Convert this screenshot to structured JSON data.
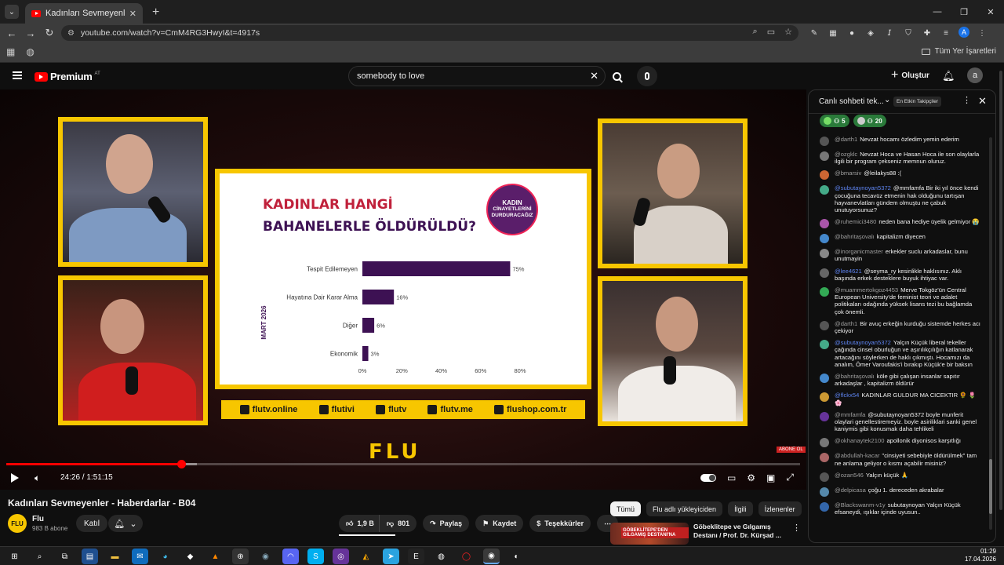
{
  "browser": {
    "tab_title": "Kadınları Sevmeyenler - Haberdarlar",
    "url": "youtube.com/watch?v=CmM4RG3HwyI&t=4917s",
    "profile_initial": "A",
    "bookmarks_label": "Tüm Yer İşaretleri"
  },
  "yt": {
    "logo": "Premium",
    "logo_sup": "AT",
    "search_value": "somebody to love",
    "create_label": "Oluştur",
    "account_initial": "a"
  },
  "video": {
    "slide_title_1": "KADINLAR HANGİ",
    "slide_title_2": "BAHANELERLE ÖLDÜRÜLDÜ?",
    "badge_line1": "KADIN",
    "badge_line2": "CİNAYETLERİNİ",
    "badge_line3": "DURDURACAĞIZ",
    "social": [
      {
        "label": "flutv.online"
      },
      {
        "label": "flutivi"
      },
      {
        "label": "flutv"
      },
      {
        "label": "flutv.me"
      },
      {
        "label": "flushop.com.tr"
      }
    ],
    "brand": "FLU",
    "abone": "ABONE OL",
    "time": "24:26 / 1:51:15",
    "progress_played": 0.22,
    "progress_buffered": 0.24
  },
  "chart_data": {
    "type": "bar",
    "orientation": "horizontal",
    "title": "KADINLAR HANGİ BAHANELERLE ÖLDÜRÜLDÜ?",
    "ylabel": "MART 2026",
    "categories": [
      "Tespit Edilemeyen",
      "Hayatına Dair Karar Alma",
      "Diğer",
      "Ekonomik"
    ],
    "values": [
      75,
      16,
      6,
      3
    ],
    "value_labels": [
      "75%",
      "16%",
      "6%",
      "3%"
    ],
    "xticks": [
      "0%",
      "20%",
      "40%",
      "60%",
      "80%"
    ],
    "xlim": [
      0,
      80
    ],
    "bar_color": "#3d1153"
  },
  "below": {
    "title": "Kadınları Sevmeyenler - Haberdarlar - B04",
    "channel": "Flu",
    "channel_avatar": "FLU",
    "subs": "983 B abone",
    "joined": "Katıl",
    "likes": "1,9 B",
    "dislikes": "801",
    "share": "Paylaş",
    "save": "Kaydet",
    "thanks": "Teşekkürler",
    "chips": [
      "Tümü",
      "Flu adlı yükleyiciden",
      "İlgili",
      "İzlenenler"
    ],
    "reco_title": "Göbeklitepe ve Gılgamış Destanı / Prof. Dr. Kürşad ...",
    "reco_thumb_text": "GÖBEKLİTEPE'DEN GILGAMIŞ DESTANI'NA"
  },
  "chat": {
    "title": "Canlı sohbeti tek...",
    "top_fans": "En Etkin Takipçiler",
    "gift1": "5",
    "gift2": "20",
    "messages": [
      {
        "author": "@darth1",
        "text": "Nevzat hocamı özledim yemin ederim",
        "color": "#555"
      },
      {
        "author": "@ozgklc",
        "text": "Nevzat Hoca ve Hasan Hoca ile son olaylarla ilgili bir program çekseniz memnun oluruz.",
        "color": "#777"
      },
      {
        "author": "@bmarsiv",
        "text": "@leilakys88 :(",
        "color": "#c63"
      },
      {
        "author": "@subutaynoyan5372",
        "text": "@mmfamfa Bir iki yıl önce kendi çocuğuna tecavüz etmenin hak olduğunu tartışan hayvanevlatları gündem olmuştu ne çabuk unutuyorsunuz?",
        "color": "#4a8",
        "mod": true
      },
      {
        "author": "@ruhemici3480",
        "text": "neden bana hediye üyelik gelmiyor 😭",
        "color": "#a5a"
      },
      {
        "author": "@bahritaşovalı",
        "text": "kapitalizm diyecen",
        "color": "#48c"
      },
      {
        "author": "@inorganicmaster",
        "text": "erkekler suclu arkadaslar, bunu unutmayin",
        "color": "#888"
      },
      {
        "author": "@lee4621",
        "text": "@seyma_ry kesinlikle haklısınız. Aklı başında erkek desteklere buyuk ihtiyac var.",
        "color": "#666",
        "mod": true
      },
      {
        "author": "@muammertokgoz4453",
        "text": "Merve Tokgöz'ün Central European University'de feminist teori ve adalet politikaları odağında yüksek lisans tezi bu bağlamda çok önemli.",
        "color": "#3a5"
      },
      {
        "author": "@darth1",
        "text": "Bir avuç erkeğin kurduğu sistemde herkes acı çekiyor",
        "color": "#555"
      },
      {
        "author": "@subutaynoyan5372",
        "text": "Yalçın Küçük liberal tekeller çağında cinsel oburluğun ve aşırılıkçılığın katlanarak artacağını söylerken de haklı çıkmıştı. Hocamızı da analım, Ömer Varoufakis'i bırakıp Küçük'e bir baksın",
        "color": "#4a8",
        "mod": true
      },
      {
        "author": "@bahritaşovalı",
        "text": "köle gibi çalışan insanlar sapıtır arkadaşlar , kapitalizm öldürür",
        "color": "#48c"
      },
      {
        "author": "@flckx54",
        "text": "KADINLAR GULDUR MA CICEKTIR 🌻 🌷 🌸",
        "color": "#c93",
        "mod": true
      },
      {
        "author": "@mmfamfa",
        "text": "@subutaynoyan5372 boyle munferit olaylari genellestiremeyiz. boyle asiriliklari sanki genel kaniymis gibi konusmak daha tehlikeli",
        "color": "#639"
      },
      {
        "author": "@okhanaytek2100",
        "text": "apollonik diyonisos karşıtlığı",
        "color": "#777"
      },
      {
        "author": "@abdullah-kacar",
        "text": "\"cinsiyeti sebebiyle öldürülmek\" tam ne anlama geliyor o kısmı açabilir misiniz?",
        "color": "#a66"
      },
      {
        "author": "@ozan546",
        "text": "Yalçın küçük 🙏",
        "color": "#555"
      },
      {
        "author": "@delpicasa",
        "text": "çoğu 1. dereceden akrabalar",
        "color": "#58a"
      },
      {
        "author": "@Blackswanm-v1y",
        "text": "subutaynoyan Yalçın Küçük efsaneydi, ışıklar içinde uyusun..",
        "color": "#36a"
      }
    ]
  },
  "taskbar": {
    "time": "01:29",
    "date": "17.04.2026"
  }
}
